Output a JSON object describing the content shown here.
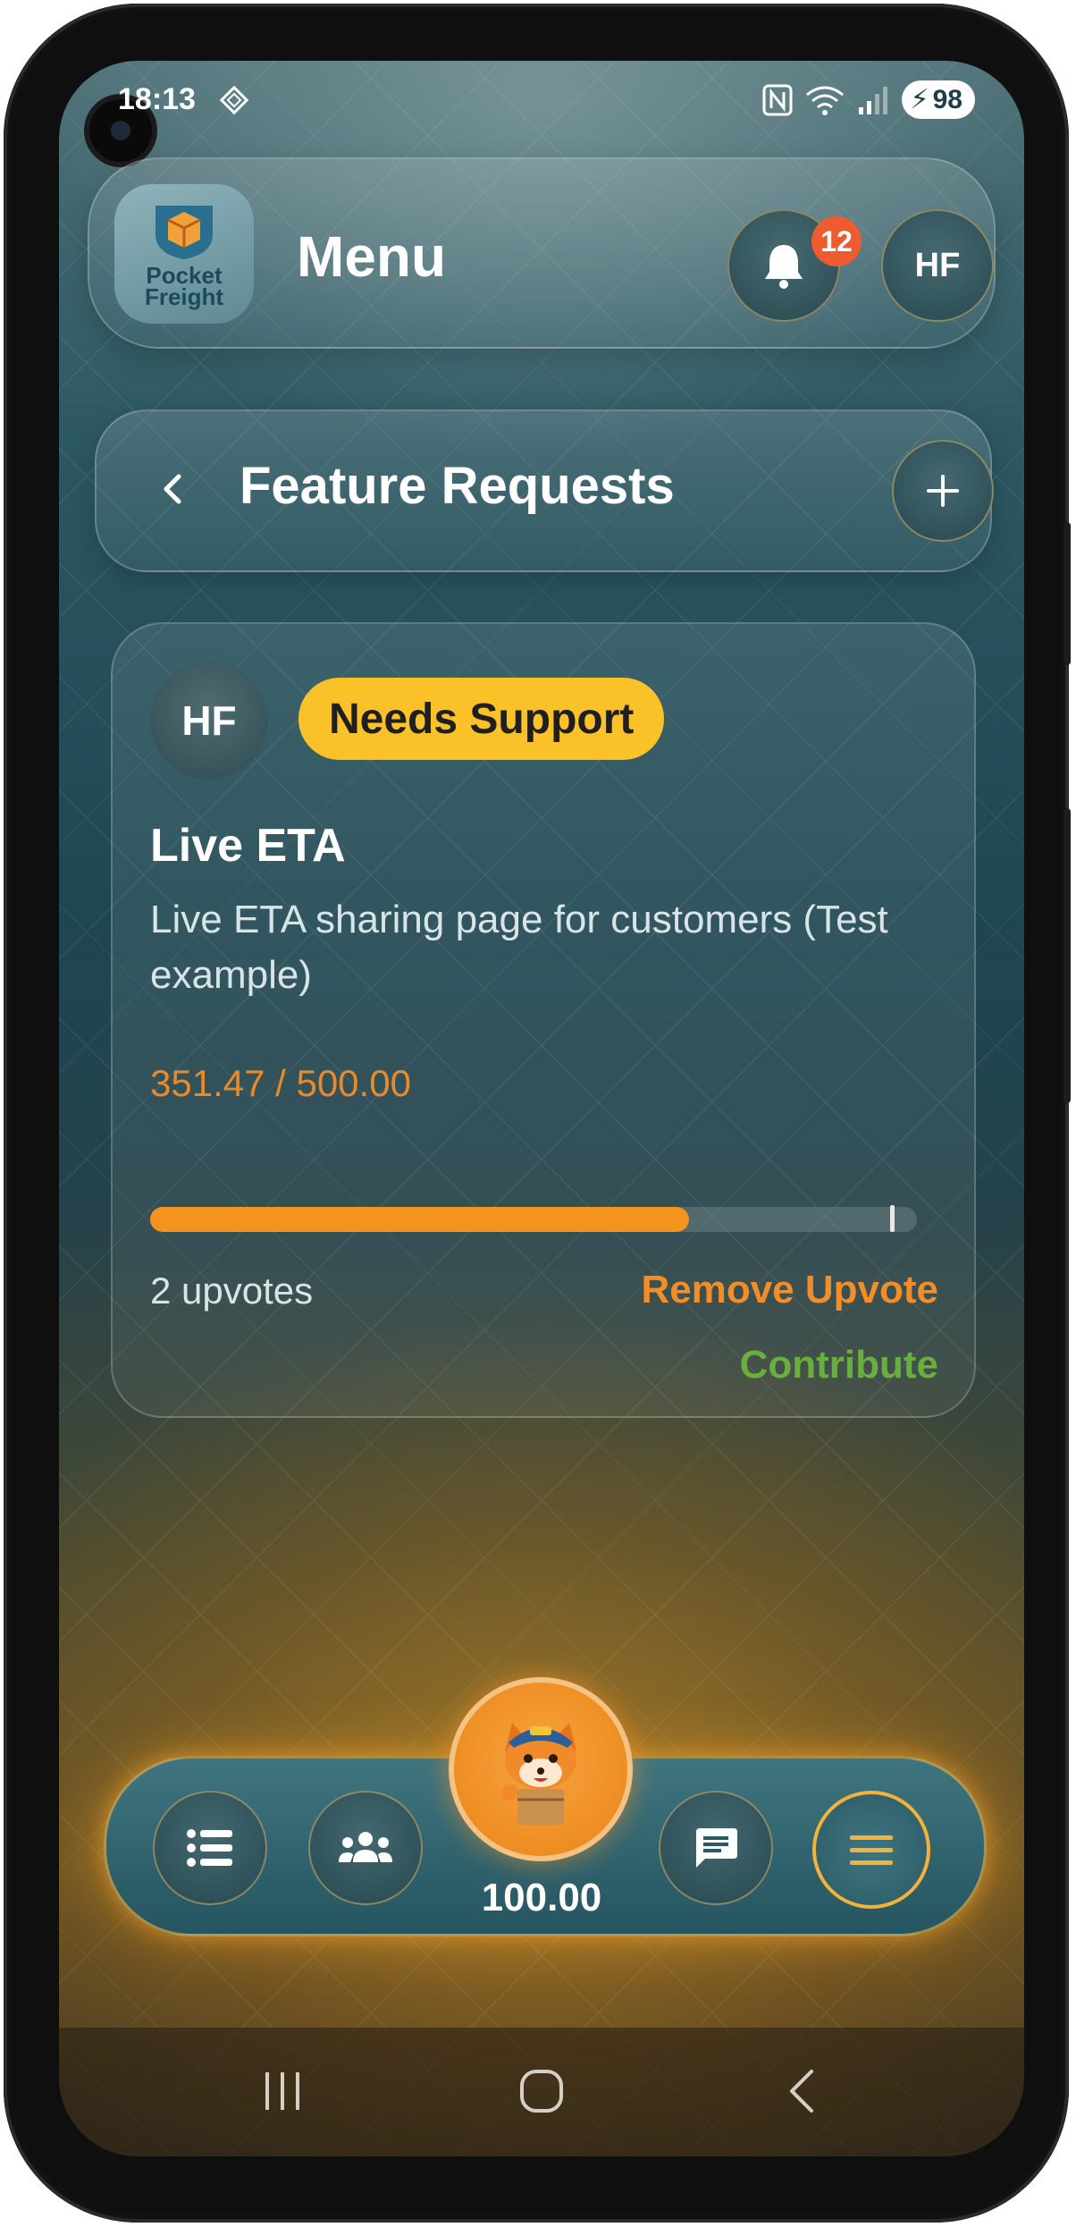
{
  "status_bar": {
    "time": "18:13",
    "battery": "98"
  },
  "header": {
    "logo_line1": "Pocket",
    "logo_line2": "Freight",
    "title": "Menu",
    "notification_count": "12",
    "user_initials": "HF"
  },
  "subheader": {
    "title": "Feature Requests"
  },
  "request": {
    "author_initials": "HF",
    "status": "Needs Support",
    "title": "Live ETA",
    "description": "Live ETA sharing page for customers (Test example)",
    "amount_text": "351.47 / 500.00",
    "progress_fraction": 0.703,
    "upvotes_text": "2 upvotes",
    "remove_upvote_label": "Remove Upvote",
    "contribute_label": "Contribute"
  },
  "bottom_nav": {
    "balance": "100.00",
    "items": [
      {
        "icon": "list-icon"
      },
      {
        "icon": "group-icon"
      },
      {
        "icon": "fox-mascot-icon"
      },
      {
        "icon": "chat-icon"
      },
      {
        "icon": "menu-icon"
      }
    ]
  },
  "colors": {
    "accent_orange": "#f5931f",
    "status_yellow": "#fac228",
    "contribute_green": "#6aae3e",
    "badge_red": "#ee5b2e"
  }
}
